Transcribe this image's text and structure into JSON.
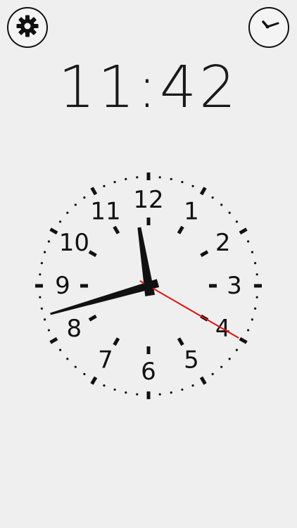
{
  "header": {
    "settings_icon": "gear-icon",
    "clock_icon": "clock-icon"
  },
  "digital_clock": {
    "time": "11:42"
  },
  "analog_clock": {
    "numerals": [
      "12",
      "1",
      "2",
      "3",
      "4",
      "5",
      "6",
      "7",
      "8",
      "9",
      "10",
      "11"
    ],
    "hour": 11,
    "minute": 42,
    "second": 20,
    "colors": {
      "hands": "#111111",
      "second_hand": "#e01010",
      "marks": "#111111",
      "background": "#efefef"
    }
  }
}
